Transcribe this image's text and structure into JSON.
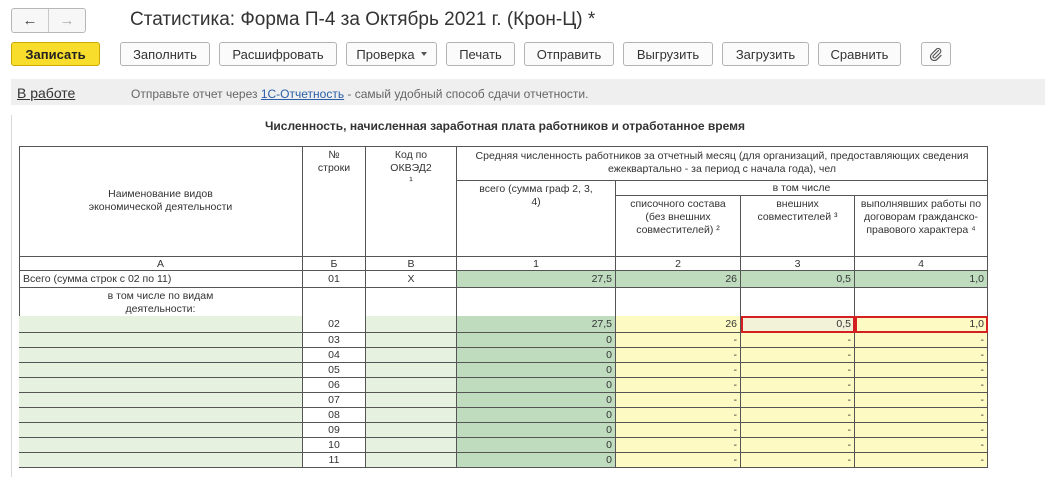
{
  "window": {
    "title": "Статистика: Форма П-4 за Октябрь 2021 г. (Крон-Ц) *",
    "nav_back": "←",
    "nav_forward": "→"
  },
  "toolbar": {
    "record": "Записать",
    "fill": "Заполнить",
    "decode": "Расшифровать",
    "check": "Проверка",
    "print": "Печать",
    "send": "Отправить",
    "export": "Выгрузить",
    "import": "Загрузить",
    "compare": "Сравнить",
    "attach_icon": "paperclip-icon"
  },
  "info": {
    "status": "В работе",
    "text_before": "Отправьте отчет через ",
    "link": "1С-Отчетность",
    "text_after": " - самый удобный способ сдачи отчетности."
  },
  "report": {
    "title": "Численность, начисленная заработная плата работников и отработанное время",
    "headers": {
      "name": "Наименование видов экономической деятельности",
      "row_no": "№ строки",
      "okved": "Код по ОКВЭД2 ¹",
      "avg_headcount": "Средняя численность работников за отчетный месяц (для организаций, предоставляющих сведения ежеквартально - за период с начала года), чел",
      "total": "всего (сумма граф 2, 3, 4)",
      "including": "в том числе",
      "payroll": "списочного состава (без внешних совместителей) ²",
      "external": "внешних совместителей ³",
      "contract": "выполнявших работы по договорам гражданско-правового характера ⁴"
    },
    "col_letters": [
      "А",
      "Б",
      "В",
      "1",
      "2",
      "3",
      "4"
    ],
    "total_row": {
      "name": "Всего (сумма строк с 02 по 11)",
      "no": "01",
      "okved": "Х",
      "c1": "27,5",
      "c2": "26",
      "c3": "0,5",
      "c4": "1,0"
    },
    "subheading": "в том числе по видам деятельности:",
    "rows": [
      {
        "no": "02",
        "c1": "27,5",
        "c2": "26",
        "c3": "0,5",
        "c4": "1,0"
      },
      {
        "no": "03",
        "c1": "0",
        "c2": "-",
        "c3": "-",
        "c4": "-"
      },
      {
        "no": "04",
        "c1": "0",
        "c2": "-",
        "c3": "-",
        "c4": "-"
      },
      {
        "no": "05",
        "c1": "0",
        "c2": "-",
        "c3": "-",
        "c4": "-"
      },
      {
        "no": "06",
        "c1": "0",
        "c2": "-",
        "c3": "-",
        "c4": "-"
      },
      {
        "no": "07",
        "c1": "0",
        "c2": "-",
        "c3": "-",
        "c4": "-"
      },
      {
        "no": "08",
        "c1": "0",
        "c2": "-",
        "c3": "-",
        "c4": "-"
      },
      {
        "no": "09",
        "c1": "0",
        "c2": "-",
        "c3": "-",
        "c4": "-"
      },
      {
        "no": "10",
        "c1": "0",
        "c2": "-",
        "c3": "-",
        "c4": "-"
      },
      {
        "no": "11",
        "c1": "0",
        "c2": "-",
        "c3": "-",
        "c4": "-"
      }
    ]
  }
}
